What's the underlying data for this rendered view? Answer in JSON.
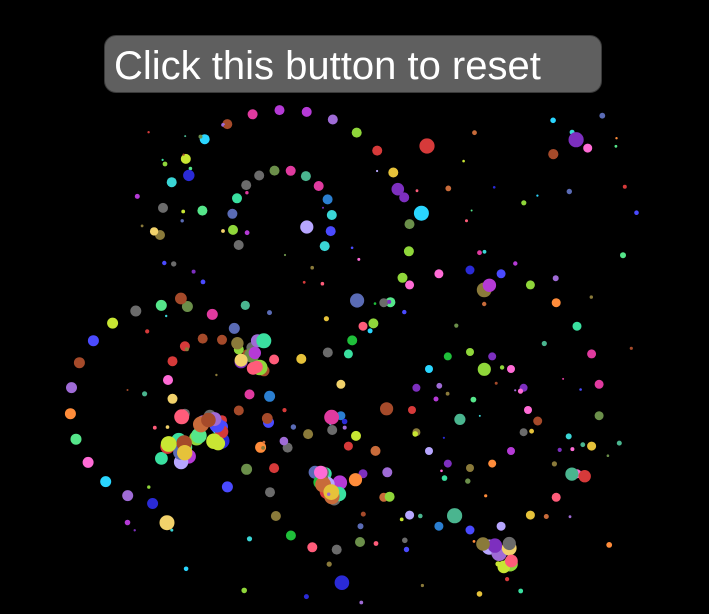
{
  "reset_button": {
    "label": "Click this button to reset"
  },
  "colors": {
    "background": "#000000",
    "button_background": "#5f5f5f",
    "button_text": "#ffffff"
  }
}
